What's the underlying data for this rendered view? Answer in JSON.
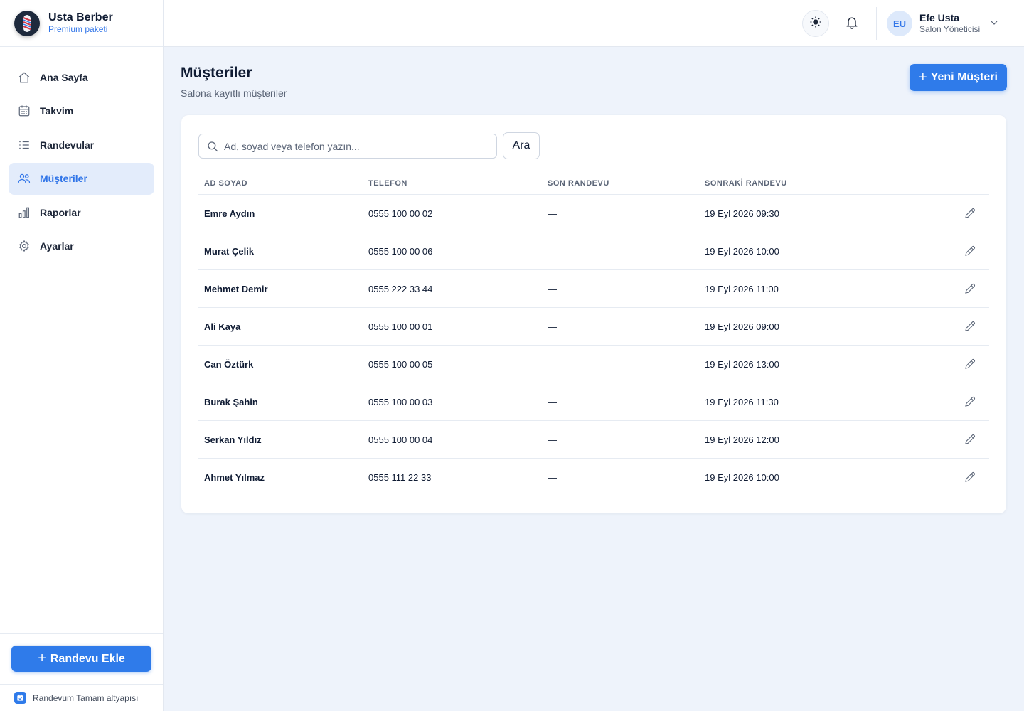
{
  "brand": {
    "name": "Usta Berber",
    "plan": "Premium paketi"
  },
  "sidebar": {
    "items": [
      {
        "label": "Ana Sayfa",
        "icon": "home-icon"
      },
      {
        "label": "Takvim",
        "icon": "calendar-icon"
      },
      {
        "label": "Randevular",
        "icon": "list-icon"
      },
      {
        "label": "Müşteriler",
        "icon": "users-icon",
        "active": true
      },
      {
        "label": "Raporlar",
        "icon": "bar-chart-icon"
      },
      {
        "label": "Ayarlar",
        "icon": "gear-icon"
      }
    ],
    "add_button": "Randevu Ekle",
    "powered_by": "Randevum Tamam altyapısı"
  },
  "header": {
    "user_initials": "EU",
    "user_name": "Efe Usta",
    "user_role": "Salon Yöneticisi"
  },
  "page": {
    "title": "Müşteriler",
    "subtitle": "Salona kayıtlı müşteriler",
    "new_button": "Yeni Müşteri",
    "search_placeholder": "Ad, soyad veya telefon yazın...",
    "search_value": "",
    "search_button": "Ara"
  },
  "table": {
    "columns": [
      "AD SOYAD",
      "TELEFON",
      "SON RANDEVU",
      "SONRAKİ RANDEVU"
    ],
    "rows": [
      {
        "name": "Emre Aydın",
        "phone": "0555 100 00 02",
        "last": "—",
        "next": "19 Eyl 2026 09:30"
      },
      {
        "name": "Murat Çelik",
        "phone": "0555 100 00 06",
        "last": "—",
        "next": "19 Eyl 2026 10:00"
      },
      {
        "name": "Mehmet Demir",
        "phone": "0555 222 33 44",
        "last": "—",
        "next": "19 Eyl 2026 11:00"
      },
      {
        "name": "Ali Kaya",
        "phone": "0555 100 00 01",
        "last": "—",
        "next": "19 Eyl 2026 09:00"
      },
      {
        "name": "Can Öztürk",
        "phone": "0555 100 00 05",
        "last": "—",
        "next": "19 Eyl 2026 13:00"
      },
      {
        "name": "Burak Şahin",
        "phone": "0555 100 00 03",
        "last": "—",
        "next": "19 Eyl 2026 11:30"
      },
      {
        "name": "Serkan Yıldız",
        "phone": "0555 100 00 04",
        "last": "—",
        "next": "19 Eyl 2026 12:00"
      },
      {
        "name": "Ahmet Yılmaz",
        "phone": "0555 111 22 33",
        "last": "—",
        "next": "19 Eyl 2026 10:00"
      }
    ]
  },
  "colors": {
    "accent": "#2f7bea",
    "active_bg": "#e3ecfb",
    "text": "#0f1b33",
    "muted": "#5b6577"
  }
}
